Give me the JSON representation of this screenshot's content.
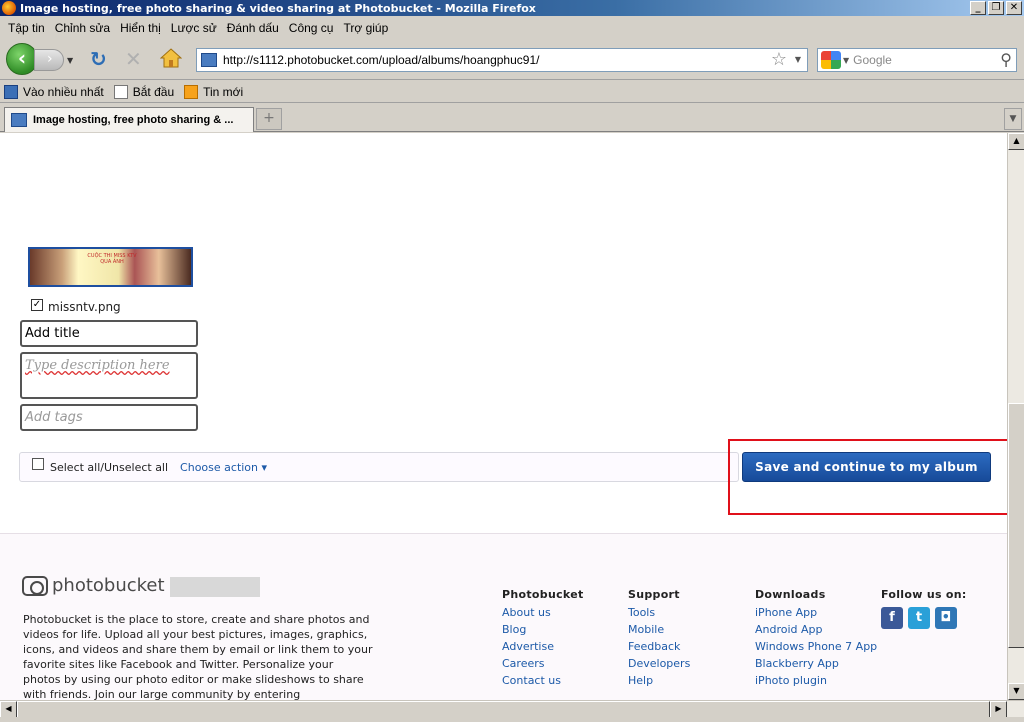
{
  "window": {
    "title": "Image hosting, free photo sharing & video sharing at Photobucket - Mozilla Firefox",
    "controls": {
      "minimize": "_",
      "restore": "❐",
      "close": "✕"
    }
  },
  "menu": [
    "Tập tin",
    "Chỉnh sửa",
    "Hiển thị",
    "Lược sử",
    "Đánh dấu",
    "Công cụ",
    "Trợ giúp"
  ],
  "nav": {
    "url": "http://s1112.photobucket.com/upload/albums/hoangphuc91/",
    "search_placeholder": "Google"
  },
  "bookmarks": [
    "Vào nhiều nhất",
    "Bắt đầu",
    "Tin mới"
  ],
  "tabs": [
    {
      "label": "Image hosting, free photo sharing & ..."
    }
  ],
  "upload": {
    "thumb_text": "CUỘC THI MISS KTV QUA ẢNH",
    "filename": "missntv.png",
    "file_checked": true,
    "title_value": "Add title",
    "description_placeholder": "Type description here",
    "tags_placeholder": "Add tags",
    "select_all_label": "Select all/Unselect all",
    "choose_action_label": "Choose action ▾",
    "save_button_label": "Save and continue to my album"
  },
  "footer": {
    "logo_text": "photobucket",
    "about": "Photobucket is the place to store, create and share photos and videos for life. Upload all your best pictures, images, graphics, icons, and videos and share them by email or link them to your favorite sites like Facebook and Twitter. Personalize your photos by using our photo editor or make slideshows to share with friends. Join our large community by entering competitions or",
    "columns": [
      {
        "heading": "Photobucket",
        "links": [
          "About us",
          "Blog",
          "Advertise",
          "Careers",
          "Contact us"
        ]
      },
      {
        "heading": "Support",
        "links": [
          "Tools",
          "Mobile",
          "Feedback",
          "Developers",
          "Help"
        ]
      },
      {
        "heading": "Downloads",
        "links": [
          "iPhone App",
          "Android App",
          "Windows Phone 7 App",
          "Blackberry App",
          "iPhoto plugin"
        ]
      }
    ],
    "follow_heading": "Follow us on:",
    "social_icons": [
      "facebook-icon",
      "twitter-icon",
      "photobucket-icon"
    ]
  },
  "colors": {
    "accent_button": "#1f5bb0",
    "highlight_box": "#e0101a",
    "link": "#1d5aa8"
  }
}
